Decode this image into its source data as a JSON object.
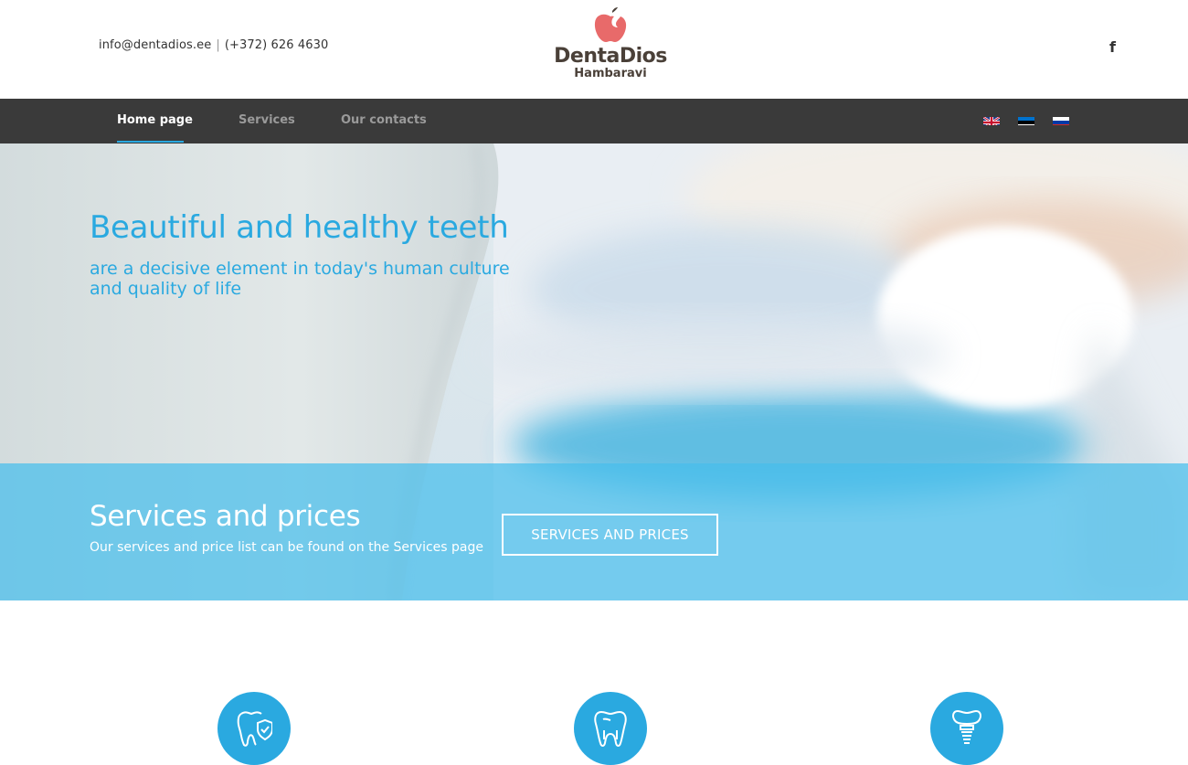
{
  "header": {
    "email": "info@dentadios.ee",
    "separator": "|",
    "phone": "(+372) 626 4630",
    "logo": {
      "brand": "DentaDios",
      "tagline": "Hambaravi",
      "apple_color": "#e86a6a",
      "text_color": "#4a4038"
    },
    "social_icon": "facebook-icon",
    "social_glyph": "f"
  },
  "nav": {
    "items": [
      {
        "label": "Home page",
        "active": true
      },
      {
        "label": "Services",
        "active": false
      },
      {
        "label": "Our contacts",
        "active": false
      }
    ],
    "languages": [
      "en",
      "et",
      "ru"
    ],
    "background": "#3a3a3a",
    "accent": "#2aa9e0"
  },
  "hero": {
    "title": "Beautiful and healthy teeth",
    "subtitle": "are a decisive element in today's human culture and quality of life",
    "title_color": "#2aa9e0"
  },
  "services_band": {
    "title": "Services and prices",
    "subtitle": "Our services and price list can be found on the Services page",
    "button_label": "SERVICES AND PRICES",
    "background": "#46beeb"
  },
  "features": {
    "icons": [
      "tooth-shield-icon",
      "tooth-icon",
      "dental-implant-icon"
    ],
    "color": "#2aa9e0"
  }
}
